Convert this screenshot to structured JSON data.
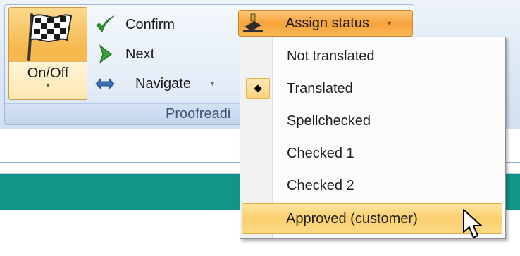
{
  "ribbon": {
    "group_caption": "Proofreadi",
    "onoff": {
      "label": "On/Off",
      "icon": "checkered-flag-icon"
    },
    "confirm": {
      "label": "Confirm",
      "icon": "checkmark-icon"
    },
    "next": {
      "label": "Next",
      "icon": "next-arrow-icon"
    },
    "navigate": {
      "label": "Navigate",
      "icon": "navigate-arrows-icon"
    },
    "assign_status": {
      "label": "Assign status",
      "icon": "stamp-icon"
    }
  },
  "dropdown": {
    "items": [
      {
        "label": "Not translated",
        "checked": false
      },
      {
        "label": "Translated",
        "checked": true
      },
      {
        "label": "Spellchecked",
        "checked": false
      },
      {
        "label": "Checked 1",
        "checked": false
      },
      {
        "label": "Checked 2",
        "checked": false
      },
      {
        "label": "Approved (customer)",
        "checked": false,
        "hovered": true
      }
    ]
  },
  "colors": {
    "accent_orange": "#f7a23a",
    "hover_yellow": "#fbd06f",
    "teal": "#129589",
    "ribbon_blue": "#dde8f5"
  }
}
